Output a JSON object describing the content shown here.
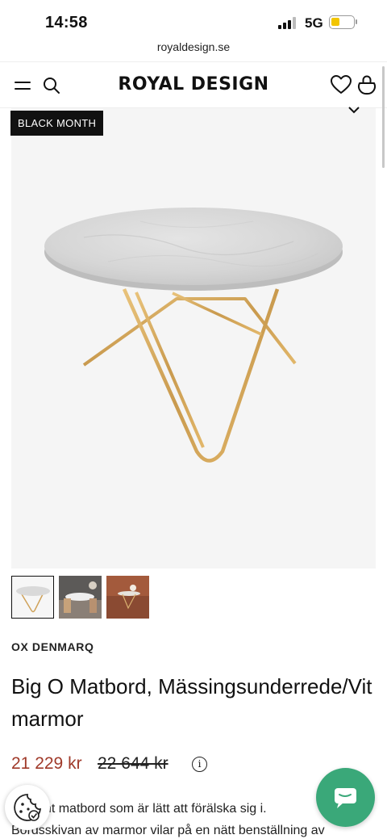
{
  "status_bar": {
    "time": "14:58",
    "network": "5G",
    "battery_level": 0.3,
    "battery_color": "#f2c500"
  },
  "browser": {
    "url": "royaldesign.se"
  },
  "header": {
    "logo": "ROYAL DESIGN",
    "icons": [
      "menu-icon",
      "search-icon",
      "heart-icon",
      "bag-icon"
    ]
  },
  "product": {
    "badge": "BLACK MONTH",
    "brand": "OX DENMARQ",
    "title": "Big O Matbord, Mässingsunderrede/Vit marmor",
    "price_sale": "21 229 kr",
    "price_original": "22 644 kr",
    "price_sale_color": "#a03a2a",
    "thumbnails": [
      "thumbnail-table-white",
      "thumbnail-dining-room",
      "thumbnail-table-warm-room"
    ],
    "selected_thumbnail": 1,
    "description": [
      "Elegant matbord som är lätt att förälska sig i.",
      "Bordsskivan av marmor vilar på en nätt benställning av"
    ]
  },
  "floating": {
    "chat_color": "#3aa879",
    "icons": [
      "cookie-icon",
      "chat-icon"
    ]
  }
}
